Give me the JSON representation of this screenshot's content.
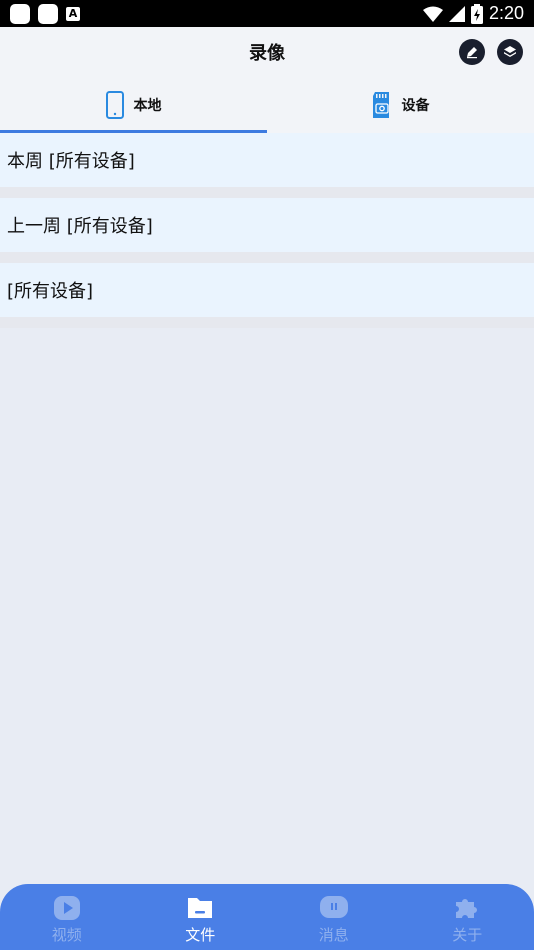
{
  "status_bar": {
    "time": "2:20",
    "indicator_a": "A"
  },
  "header": {
    "title": "录像"
  },
  "tabs": [
    {
      "label": "本地",
      "icon": "phone-icon",
      "active": true
    },
    {
      "label": "设备",
      "icon": "sd-card-camera-icon",
      "active": false
    }
  ],
  "list": [
    {
      "label": "本周  [所有设备]"
    },
    {
      "label": "上一周  [所有设备]"
    },
    {
      "label": "[所有设备]"
    }
  ],
  "bottom_nav": [
    {
      "label": "视频",
      "icon": "play-icon",
      "active": false
    },
    {
      "label": "文件",
      "icon": "folder-icon",
      "active": true
    },
    {
      "label": "消息",
      "icon": "message-icon",
      "active": false
    },
    {
      "label": "关于",
      "icon": "puzzle-icon",
      "active": false
    }
  ],
  "colors": {
    "accent": "#3d7be0",
    "nav_bg": "#4a7fe6",
    "row_bg": "#eaf4fe"
  }
}
